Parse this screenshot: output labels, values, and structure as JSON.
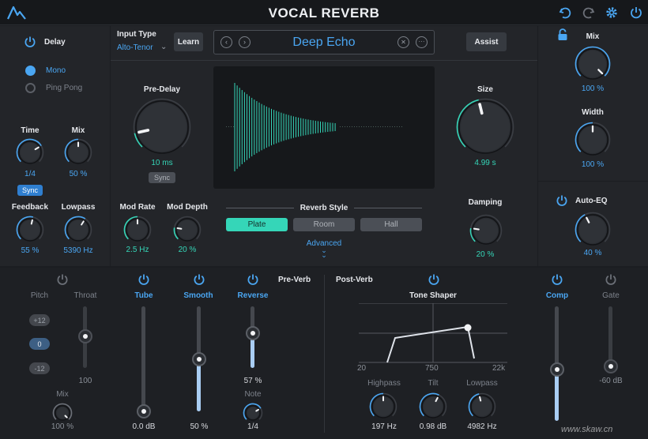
{
  "header": {
    "title": "VOCAL REVERB",
    "icons": [
      "logo-icon",
      "undo-icon",
      "redo-icon",
      "gear-icon",
      "power-icon"
    ]
  },
  "delay": {
    "label": "Delay",
    "mode_options": [
      "Mono",
      "Ping Pong"
    ],
    "selected_mode": "Mono",
    "time_label": "Time",
    "time_value": "1/4",
    "sync_label": "Sync",
    "mix_label": "Mix",
    "mix_value": "50 %",
    "feedback_label": "Feedback",
    "feedback_value": "55 %",
    "lowpass_label": "Lowpass",
    "lowpass_value": "5390 Hz"
  },
  "input": {
    "label": "Input Type",
    "value": "Alto-Tenor",
    "learn_label": "Learn"
  },
  "preset": {
    "name": "Deep Echo",
    "assist_label": "Assist"
  },
  "reverb": {
    "predelay_label": "Pre-Delay",
    "predelay_value": "10 ms",
    "predelay_sync_label": "Sync",
    "size_label": "Size",
    "size_value": "4.99 s",
    "modrate_label": "Mod Rate",
    "modrate_value": "2.5 Hz",
    "moddepth_label": "Mod Depth",
    "moddepth_value": "20 %",
    "style_label": "Reverb Style",
    "style_options": [
      "Plate",
      "Room",
      "Hall"
    ],
    "selected_style": "Plate",
    "advanced_label": "Advanced",
    "damping_label": "Damping",
    "damping_value": "20 %"
  },
  "output": {
    "mix_label": "Mix",
    "mix_value": "100 %",
    "width_label": "Width",
    "width_value": "100 %",
    "autoeq_label": "Auto-EQ",
    "autoeq_value": "40 %"
  },
  "preverb": {
    "title": "Pre-Verb",
    "pitch_label": "Pitch",
    "pitch_options": [
      "+12",
      "0",
      "-12"
    ],
    "selected_pitch": "0",
    "throat_label": "Throat",
    "throat_value": "100",
    "mix_label": "Mix",
    "mix_value": "100 %",
    "tube_label": "Tube",
    "tube_value": "0.0 dB",
    "smooth_label": "Smooth",
    "smooth_value": "50 %",
    "reverse_label": "Reverse",
    "reverse_value": "57 %",
    "note_label": "Note",
    "note_value": "1/4",
    "smooth_level": 0.5,
    "reverse_level": 0.57
  },
  "postverb": {
    "title": "Post-Verb",
    "tone_shaper_label": "Tone Shaper",
    "freq_ticks": [
      "20",
      "750",
      "22k"
    ],
    "highpass_label": "Highpass",
    "highpass_value": "197 Hz",
    "tilt_label": "Tilt",
    "tilt_value": "0.98 dB",
    "lowpass_label": "Lowpass",
    "lowpass_value": "4982 Hz",
    "comp_label": "Comp",
    "gate_label": "Gate",
    "gate_value": "-60 dB",
    "comp_level": 0.45
  },
  "colors": {
    "accent_blue": "#4aa6f2",
    "accent_teal": "#35d6b8",
    "panel": "#232529",
    "background": "#1b1d21"
  },
  "watermark": "www.skaw.cn"
}
